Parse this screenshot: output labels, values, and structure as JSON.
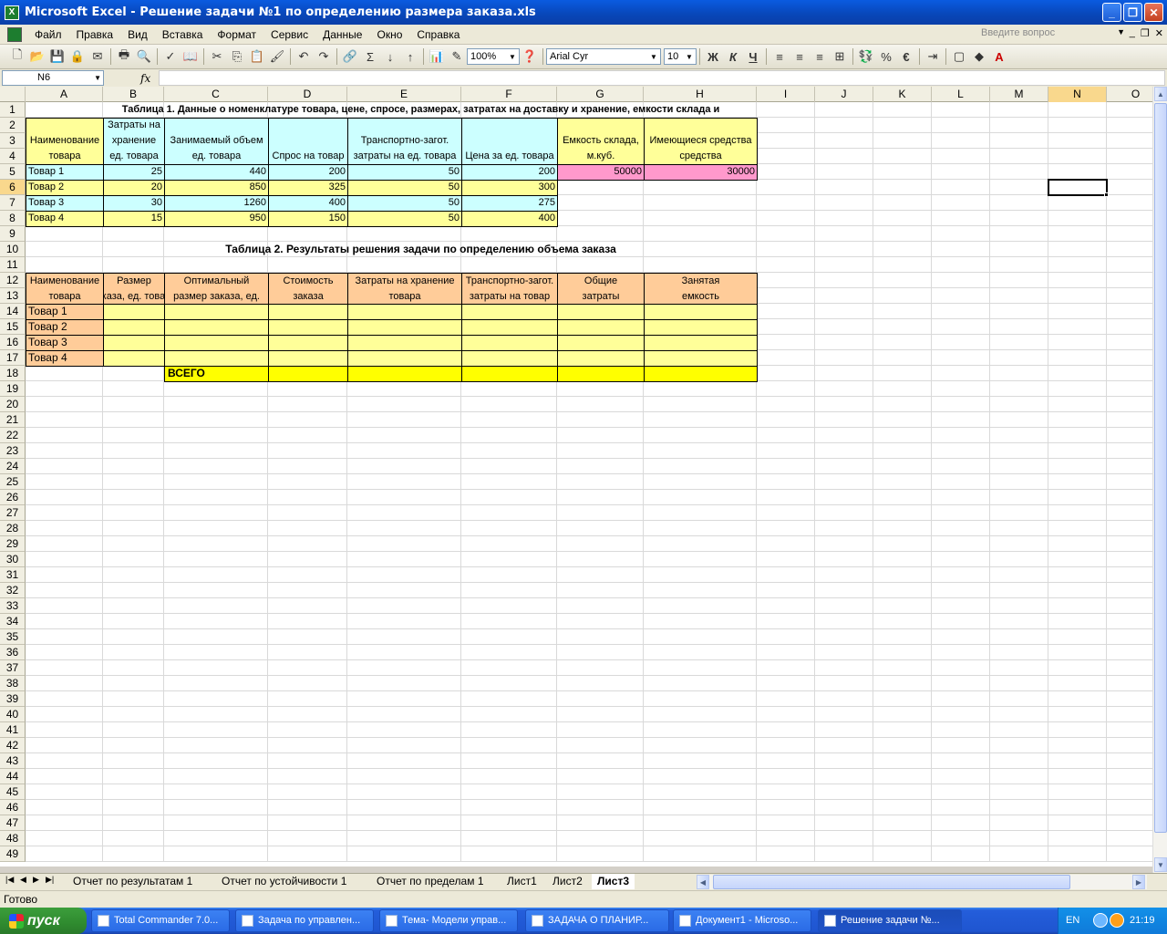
{
  "window": {
    "title": "Microsoft Excel - Решение задачи №1 по определению размера заказа.xls"
  },
  "menu": {
    "items": [
      "Файл",
      "Правка",
      "Вид",
      "Вставка",
      "Формат",
      "Сервис",
      "Данные",
      "Окно",
      "Справка"
    ],
    "ask_placeholder": "Введите вопрос"
  },
  "toolbar": {
    "zoom": "100%",
    "font": "Arial Cyr",
    "font_size": "10",
    "bold": "Ж",
    "italic": "К",
    "underline": "Ч",
    "percent": "%",
    "euro": "€"
  },
  "formula_bar": {
    "name_box": "N6",
    "fx": "fx",
    "value": ""
  },
  "columns": [
    "A",
    "B",
    "C",
    "D",
    "E",
    "F",
    "G",
    "H",
    "I",
    "J",
    "K",
    "L",
    "M",
    "N",
    "O"
  ],
  "selected_column": "N",
  "rows_count": 49,
  "colors": {
    "cyan": "#ccffff",
    "yellow": "#ffff99",
    "pink": "#ff99cc",
    "orange": "#ffcc99",
    "bright_yellow": "#ffff00",
    "header_sel": "#f9d88d"
  },
  "table1": {
    "title": "Таблица 1. Данные о номенклатуре товара, цене, спросе, размерах, затратах на доставку и хранение, емкости склада и",
    "headers": [
      [
        "Наименование",
        "товара"
      ],
      [
        "Затраты на",
        "хранение",
        "ед. товара"
      ],
      [
        "Занимаемый объем",
        "ед. товара"
      ],
      [
        "Спрос на товар"
      ],
      [
        "Транспортно-загот.",
        "затраты на ед. товара"
      ],
      [
        "Цена за ед. товара"
      ],
      [
        "Емкость склада,",
        "м.куб."
      ],
      [
        "Имеющиеся средства",
        "средства"
      ]
    ],
    "rows": [
      [
        "Товар 1",
        "25",
        "440",
        "200",
        "50",
        "200",
        "50000",
        "30000"
      ],
      [
        "Товар 2",
        "20",
        "850",
        "325",
        "50",
        "300"
      ],
      [
        "Товар 3",
        "30",
        "1260",
        "400",
        "50",
        "275"
      ],
      [
        "Товар 4",
        "15",
        "950",
        "150",
        "50",
        "400"
      ]
    ]
  },
  "table2": {
    "title": "Таблица 2. Результаты решения задачи по определению объема заказа",
    "headers": [
      [
        "Наименование",
        "товара"
      ],
      [
        "Размер",
        "заказа, ед. товара"
      ],
      [
        "Оптимальный",
        "размер заказа, ед."
      ],
      [
        "Стоимость",
        "заказа"
      ],
      [
        "Затраты на хранение",
        "товара"
      ],
      [
        "Транспортно-загот.",
        "затраты на товар"
      ],
      [
        "Общие",
        "затраты"
      ],
      [
        "Занятая",
        "емкость"
      ]
    ],
    "rows": [
      "Товар 1",
      "Товар 2",
      "Товар 3",
      "Товар 4"
    ],
    "total_label": "ВСЕГО"
  },
  "sheets": [
    "Отчет по результатам 1",
    "Отчет по устойчивости 1",
    "Отчет по пределам 1",
    "Лист1",
    "Лист2",
    "Лист3"
  ],
  "active_sheet": "Лист3",
  "status": "Готово",
  "taskbar": {
    "start": "пуск",
    "tasks": [
      "Total Commander 7.0...",
      "Задача по управлен...",
      "Тема- Модели управ...",
      "ЗАДАЧА О ПЛАНИР...",
      "Документ1 - Microso...",
      "Решение задачи №..."
    ],
    "lang": "EN",
    "clock": "21:19"
  }
}
